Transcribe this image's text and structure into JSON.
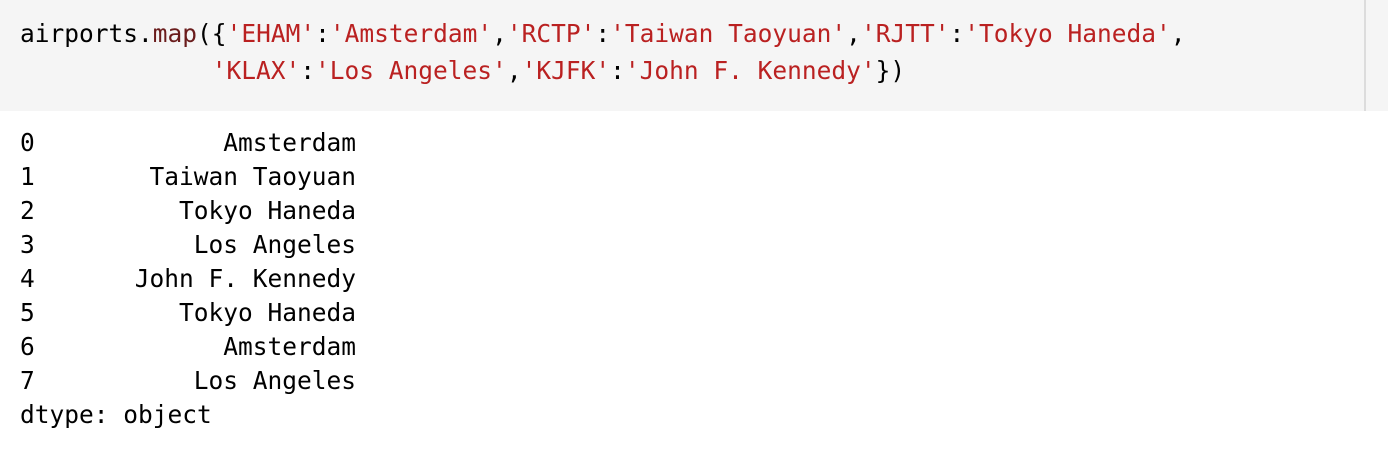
{
  "input_cell": {
    "code": {
      "var": "airports",
      "dot": ".",
      "fn": "map",
      "open": "({",
      "pairs": [
        {
          "key": "'EHAM'",
          "value": "'Amsterdam'"
        },
        {
          "key": "'RCTP'",
          "value": "'Taiwan Taoyuan'"
        },
        {
          "key": "'RJTT'",
          "value": "'Tokyo Haneda'"
        },
        {
          "key": "'KLAX'",
          "value": "'Los Angeles'"
        },
        {
          "key": "'KJFK'",
          "value": "'John F. Kennedy'"
        }
      ],
      "colon": ":",
      "comma": ",",
      "close": "})",
      "indent": "             "
    }
  },
  "output": {
    "rows": [
      {
        "index": "0",
        "value": "Amsterdam"
      },
      {
        "index": "1",
        "value": "Taiwan Taoyuan"
      },
      {
        "index": "2",
        "value": "Tokyo Haneda"
      },
      {
        "index": "3",
        "value": "Los Angeles"
      },
      {
        "index": "4",
        "value": "John F. Kennedy"
      },
      {
        "index": "5",
        "value": "Tokyo Haneda"
      },
      {
        "index": "6",
        "value": "Amsterdam"
      },
      {
        "index": "7",
        "value": "Los Angeles"
      }
    ],
    "dtype": "dtype: object"
  },
  "colors": {
    "cell_background": "#f5f5f5",
    "function_name": "#6a1c1c",
    "string_literal": "#ba2121",
    "text": "#000000"
  }
}
